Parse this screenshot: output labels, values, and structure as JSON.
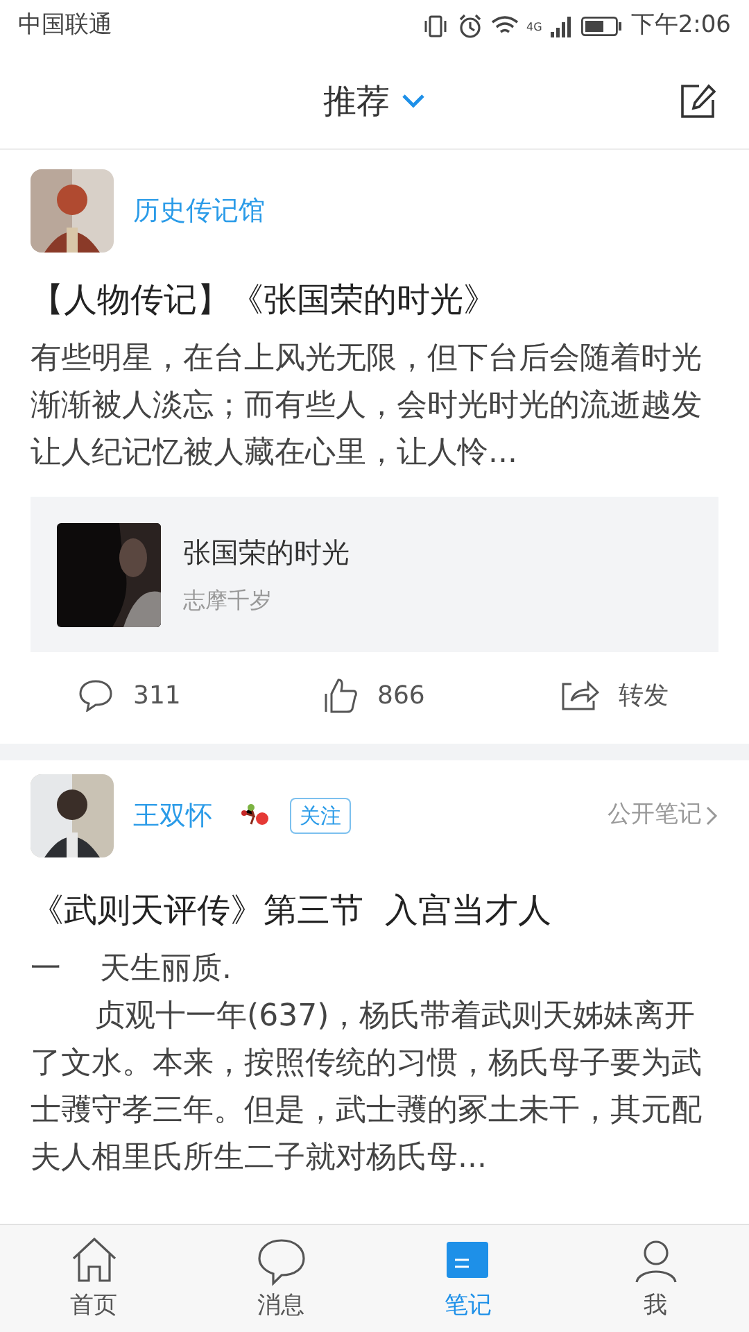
{
  "status_bar": {
    "carrier": "中国联通",
    "network": "4G",
    "time": "下午2:06"
  },
  "header": {
    "title": "推荐"
  },
  "posts": [
    {
      "author": "历史传记馆",
      "title": "【人物传记】《张国荣的时光》",
      "paragraphs": [
        "有些明星，在台上风光无限，但下台后会随着时光渐渐被人淡忘；而有些人，会时光时光的流逝越发让人纪记忆被人藏在心里，让人怜..."
      ],
      "attachment": {
        "title": "张国荣的时光",
        "subtitle": "志摩千岁"
      },
      "actions": {
        "comments": "311",
        "likes": "866",
        "share": "转发"
      }
    },
    {
      "author": "王双怀",
      "follow": "关注",
      "visibility": "公开笔记",
      "title": "《武则天评传》第三节  入宫当才人",
      "paragraphs": [
        "一    天生丽质.",
        "贞观十一年(637)，杨氏带着武则天姊妹离开了文水。本来，按照传统的习惯，杨氏母子要为武士彟守孝三年。但是，武士彟的冢土未干，其元配夫人相里氏所生二子就对杨氏母..."
      ]
    }
  ],
  "tabs": [
    {
      "label": "首页",
      "selected": false
    },
    {
      "label": "消息",
      "selected": false
    },
    {
      "label": "笔记",
      "selected": true
    },
    {
      "label": "我",
      "selected": false
    }
  ]
}
